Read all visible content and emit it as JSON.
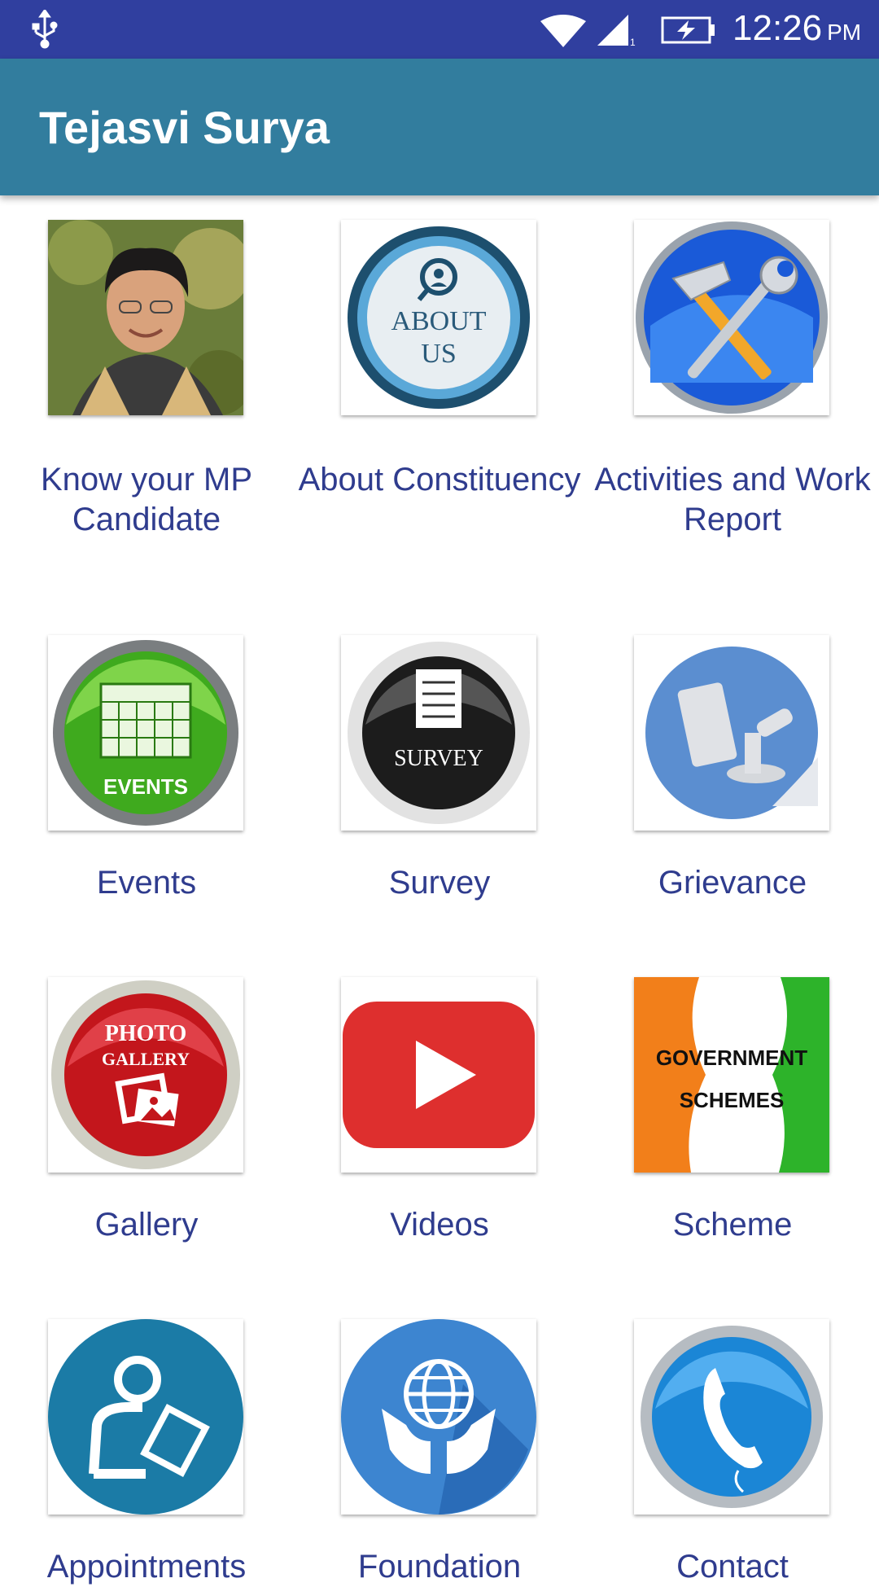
{
  "status_bar": {
    "time": "12:26",
    "ampm": "PM",
    "icons": [
      "usb-icon",
      "wifi-icon",
      "signal-icon",
      "battery-charging-icon"
    ]
  },
  "app_bar": {
    "title": "Tejasvi Surya"
  },
  "colors": {
    "status_bar": "#303f9f",
    "app_bar": "#327d9e",
    "label_text": "#2f3c8e"
  },
  "tiles": [
    {
      "label": "Know your MP Candidate",
      "icon": "candidate-photo"
    },
    {
      "label": "About Constituency",
      "icon": "about-us-icon",
      "icon_text": "ABOUT US"
    },
    {
      "label": "Activities and Work Report",
      "icon": "tools-icon"
    },
    {
      "label": "Events",
      "icon": "events-calendar-icon",
      "icon_text": "EVENTS"
    },
    {
      "label": "Survey",
      "icon": "survey-icon",
      "icon_text": "SURVEY"
    },
    {
      "label": "Grievance",
      "icon": "grievance-icon"
    },
    {
      "label": "Gallery",
      "icon": "photo-gallery-icon",
      "icon_text": "PHOTO GALLERY"
    },
    {
      "label": "Videos",
      "icon": "youtube-play-icon"
    },
    {
      "label": "Scheme",
      "icon": "government-schemes-icon",
      "icon_text": "GOVERNMENT SCHEMES"
    },
    {
      "label": "Appointments",
      "icon": "appointment-icon"
    },
    {
      "label": "Foundation",
      "icon": "foundation-globe-icon"
    },
    {
      "label": "Contact",
      "icon": "phone-icon"
    }
  ]
}
